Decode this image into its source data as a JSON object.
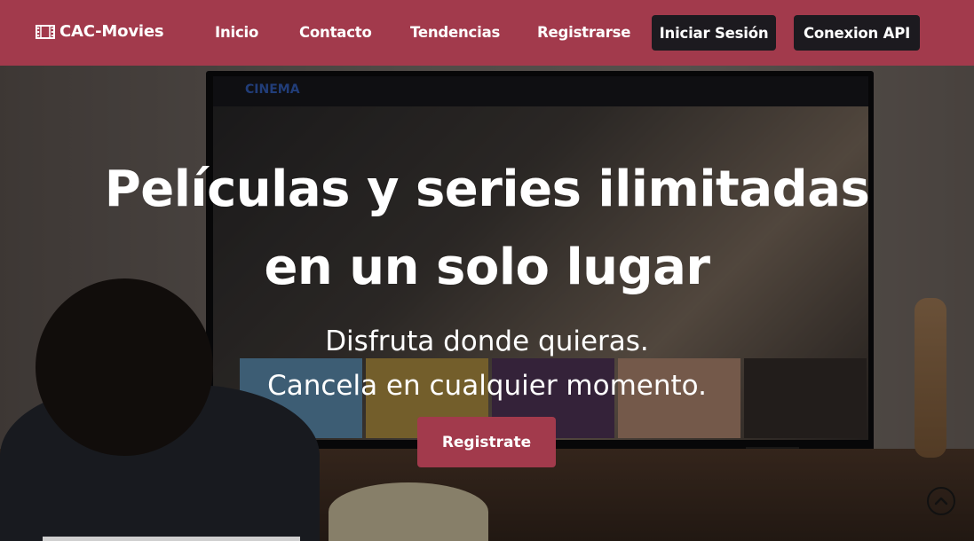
{
  "navbar": {
    "brand": "CAC-Movies",
    "brand_icon": "film-icon",
    "links": [
      "Inicio",
      "Contacto",
      "Tendencias",
      "Registrarse"
    ],
    "login_button": "Iniciar Sesión",
    "api_button": "Conexion API",
    "bg_color": "#a23a4c",
    "button_color": "#1c1a1f"
  },
  "hero": {
    "title_line1": "Películas y series ilimitadas",
    "title_line2": "en un solo lugar",
    "subtitle_line1": "Disfruta donde quieras.",
    "subtitle_line2": "Cancela en cualquier momento.",
    "cta_label": "Registrate",
    "tv_logo": "CINEMA",
    "scroll_icon": "chevron-up-circle-icon"
  }
}
